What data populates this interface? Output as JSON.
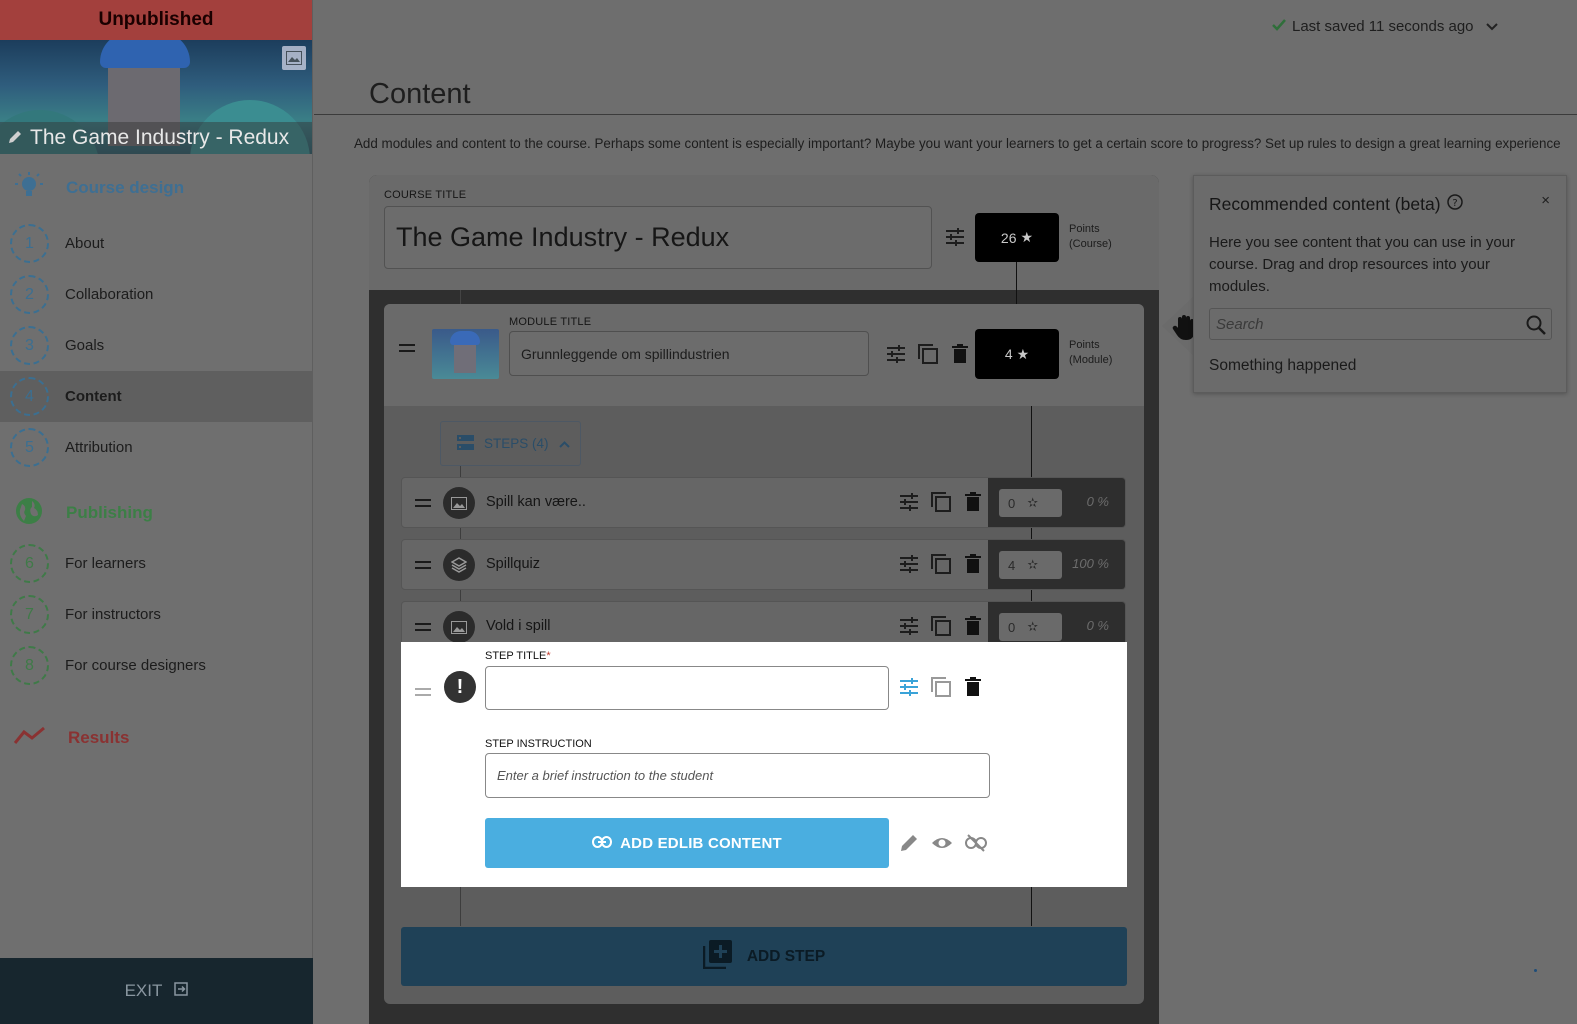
{
  "sidebar": {
    "status": "Unpublished",
    "course_title": "The Game Industry - Redux",
    "sections": {
      "design": "Course design",
      "publishing": "Publishing",
      "results": "Results"
    },
    "design_items": [
      {
        "num": "1",
        "label": "About"
      },
      {
        "num": "2",
        "label": "Collaboration"
      },
      {
        "num": "3",
        "label": "Goals"
      },
      {
        "num": "4",
        "label": "Content"
      },
      {
        "num": "5",
        "label": "Attribution"
      }
    ],
    "publishing_items": [
      {
        "num": "6",
        "label": "For learners"
      },
      {
        "num": "7",
        "label": "For instructors"
      },
      {
        "num": "8",
        "label": "For course designers"
      }
    ],
    "exit": "EXIT",
    "colors": {
      "design": "#3e6f93",
      "publishing": "#3c7f46",
      "results": "#8a3232",
      "unpublished": "#a3403d"
    }
  },
  "header": {
    "saved": "Last saved 11 seconds ago",
    "title": "Content",
    "description": "Add modules and content to the course. Perhaps some content is especially important? Maybe you want your learners to get a certain score to progress? Set up rules to design a great learning experience"
  },
  "course": {
    "label": "COURSE TITLE",
    "title": "The Game Industry - Redux",
    "points": "26",
    "points_label_1": "Points",
    "points_label_2": "(Course)"
  },
  "module": {
    "label": "MODULE TITLE",
    "title": "Grunnleggende om spillindustrien",
    "points": "4",
    "points_label_1": "Points",
    "points_label_2": "(Module)",
    "steps_toggle": "STEPS (4)"
  },
  "steps": [
    {
      "name": "Spill kan være..",
      "points": "0",
      "percent": "0 %",
      "icon": "image-icon"
    },
    {
      "name": "Spillquiz",
      "points": "4",
      "percent": "100 %",
      "icon": "layers-icon"
    },
    {
      "name": "Vold i spill",
      "points": "0",
      "percent": "0 %",
      "icon": "image-icon"
    }
  ],
  "editor": {
    "title_label": "STEP TITLE",
    "required_mark": "*",
    "title_value": "",
    "instruction_label": "STEP INSTRUCTION",
    "instruction_placeholder": "Enter a brief instruction to the student",
    "add_content": "ADD EDLIB CONTENT",
    "accent": "#4aaee0"
  },
  "add_step": "ADD STEP",
  "recommended": {
    "title": "Recommended content (beta)",
    "close": "×",
    "text": "Here you see content that you can use in your course. Drag and drop resources into your modules.",
    "search_placeholder": "Search",
    "message": "Something happened"
  }
}
